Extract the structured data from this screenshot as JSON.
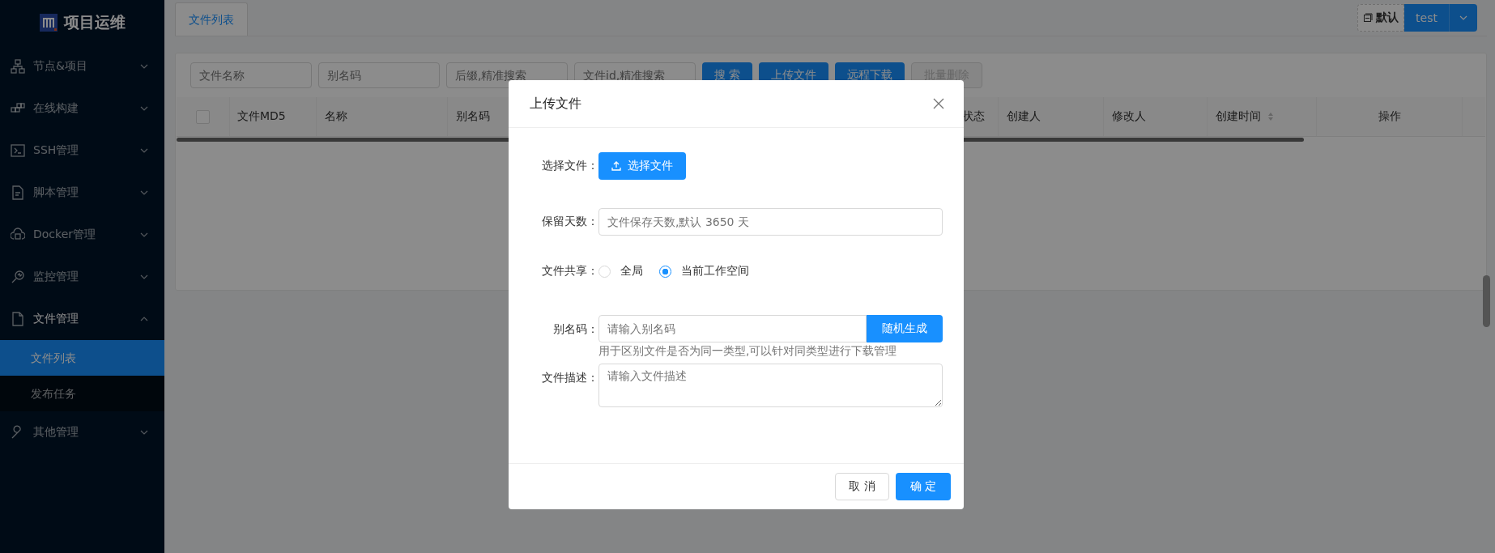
{
  "logo": {
    "text": "项目运维"
  },
  "sidebar": {
    "items": [
      {
        "label": "节点&项目",
        "expanded": false
      },
      {
        "label": "在线构建",
        "expanded": false
      },
      {
        "label": "SSH管理",
        "expanded": false
      },
      {
        "label": "脚本管理",
        "expanded": false
      },
      {
        "label": "Docker管理",
        "expanded": false
      },
      {
        "label": "监控管理",
        "expanded": false
      },
      {
        "label": "文件管理",
        "expanded": true,
        "children": [
          {
            "label": "文件列表",
            "selected": true
          },
          {
            "label": "发布任务",
            "selected": false
          }
        ]
      },
      {
        "label": "其他管理",
        "expanded": false
      }
    ]
  },
  "tabs": [
    {
      "label": "文件列表",
      "selected": true
    }
  ],
  "workspace": {
    "label": "默认",
    "user": "test"
  },
  "filters": [
    {
      "placeholder": "文件名称"
    },
    {
      "placeholder": "别名码"
    },
    {
      "placeholder": "后缀,精准搜索"
    },
    {
      "placeholder": "文件id,精准搜索"
    }
  ],
  "actions": [
    {
      "label": "搜 索",
      "disabled": false
    },
    {
      "label": "上传文件",
      "disabled": false
    },
    {
      "label": "远程下载",
      "disabled": false
    },
    {
      "label": "批量删除",
      "disabled": true
    }
  ],
  "table": {
    "select_all_checked": false,
    "columns": [
      {
        "label": "文件MD5",
        "sortable": false
      },
      {
        "label": "名称",
        "sortable": false
      },
      {
        "label": "别名码",
        "sortable": false
      },
      {
        "label": "状态",
        "sortable": false
      },
      {
        "label": "创建人",
        "sortable": false
      },
      {
        "label": "修改人",
        "sortable": false
      },
      {
        "label": "创建时间",
        "sortable": true
      },
      {
        "label": "操作",
        "sortable": false
      }
    ]
  },
  "dialog": {
    "title": "上传文件",
    "fields": [
      {
        "kind": "upload",
        "label": "选择文件：",
        "button": "选择文件"
      },
      {
        "kind": "input",
        "label": "保留天数：",
        "placeholder": "文件保存天数,默认 3650 天"
      },
      {
        "kind": "radio",
        "label": "文件共享：",
        "options": [
          {
            "label": "全局",
            "selected": false
          },
          {
            "label": "当前工作空间",
            "selected": true
          }
        ]
      },
      {
        "kind": "input-button",
        "label": "别名码：",
        "placeholder": "请输入别名码",
        "button": "随机生成",
        "help": "用于区别文件是否为同一类型,可以针对同类型进行下载管理"
      },
      {
        "kind": "textarea",
        "label": "文件描述：",
        "placeholder": "请输入文件描述"
      }
    ],
    "cancel": "取 消",
    "ok": "确 定"
  }
}
